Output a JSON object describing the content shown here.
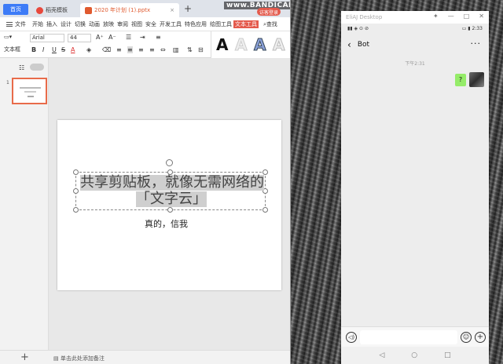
{
  "colors": {
    "accent": "#3d7bf7",
    "wps_red": "#e45a4c",
    "wechat_green": "#95ec69"
  },
  "wps": {
    "tabs": {
      "home": "首页",
      "template": "稻壳模板",
      "file": "2020 年计划 (1).pptx"
    },
    "watermark": "www.BANDICAM.com",
    "login": "访客登录",
    "menu": {
      "file": "文件",
      "items": [
        "开始",
        "插入",
        "设计",
        "切换",
        "动画",
        "放映",
        "审阅",
        "视图",
        "安全",
        "开发工具",
        "特色应用",
        "绘图工具",
        "文本工具"
      ],
      "search": "查找"
    },
    "toolbar": {
      "textbox": "文本框",
      "font_name": "Arial",
      "font_size": "44",
      "bold": "B",
      "italic": "I",
      "underline": "U",
      "strike": "S",
      "color": "A"
    },
    "wordart": [
      "A",
      "A",
      "A",
      "A"
    ],
    "thumb_number": "1",
    "slide": {
      "title_line1": "共享剪贴板，就像无需网络的",
      "title_line2": "「文字云」",
      "subtitle": "真的，信我"
    },
    "status": {
      "add": "+",
      "notes": "单击此处添加备注"
    }
  },
  "phone": {
    "window_title": "EliAJ Desktop",
    "time": "2:33",
    "chat_name": "Bot",
    "chat_timestamp": "下午2:31",
    "message": "?",
    "nav": [
      "◁",
      "○",
      "□"
    ]
  }
}
